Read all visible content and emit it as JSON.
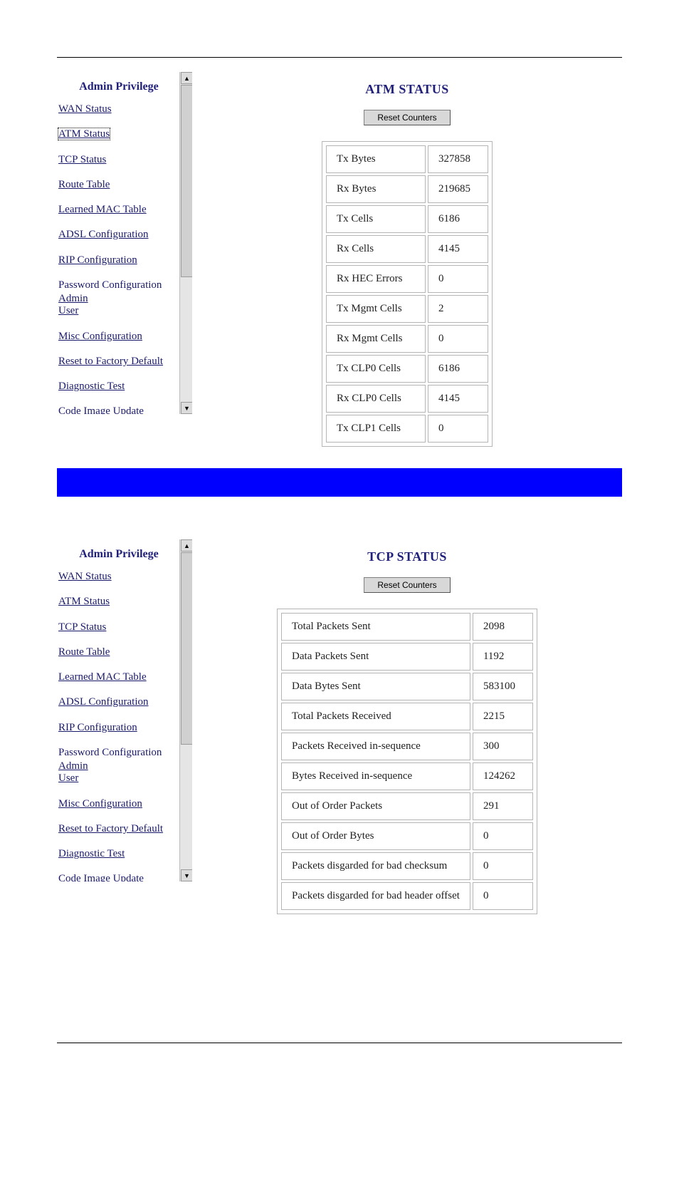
{
  "sidebar": {
    "title": "Admin Privilege",
    "items": [
      {
        "label": "WAN Status",
        "link": true
      },
      {
        "label": "ATM Status",
        "link": true,
        "selected_in_top": true
      },
      {
        "label": "TCP Status",
        "link": true
      },
      {
        "label": "Route Table",
        "link": true
      },
      {
        "label": "Learned MAC Table",
        "link": true
      },
      {
        "label": "ADSL Configuration",
        "link": true
      },
      {
        "label": "RIP Configuration",
        "link": true
      },
      {
        "label": "Password Configuration",
        "link": false,
        "sub": [
          {
            "label": "Admin"
          },
          {
            "label": "User"
          }
        ]
      },
      {
        "label": "Misc Configuration",
        "link": true
      },
      {
        "label": "Reset to Factory Default",
        "link": true
      },
      {
        "label": "Diagnostic Test",
        "link": true
      },
      {
        "label": "Code Image Update",
        "link": true
      }
    ]
  },
  "panel_top": {
    "title": "ATM STATUS",
    "reset_button": "Reset Counters",
    "rows": [
      {
        "k": "Tx Bytes",
        "v": "327858"
      },
      {
        "k": "Rx Bytes",
        "v": "219685"
      },
      {
        "k": "Tx Cells",
        "v": "6186"
      },
      {
        "k": "Rx Cells",
        "v": "4145"
      },
      {
        "k": "Rx HEC Errors",
        "v": "0"
      },
      {
        "k": "Tx Mgmt Cells",
        "v": "2"
      },
      {
        "k": "Rx Mgmt Cells",
        "v": "0"
      },
      {
        "k": "Tx CLP0 Cells",
        "v": "6186"
      },
      {
        "k": "Rx CLP0 Cells",
        "v": "4145"
      },
      {
        "k": "Tx CLP1 Cells",
        "v": "0"
      }
    ]
  },
  "panel_bottom": {
    "title": "TCP STATUS",
    "reset_button": "Reset Counters",
    "rows": [
      {
        "k": "Total Packets Sent",
        "v": "2098"
      },
      {
        "k": "Data Packets Sent",
        "v": "1192"
      },
      {
        "k": "Data Bytes Sent",
        "v": "583100"
      },
      {
        "k": "Total Packets Received",
        "v": "2215"
      },
      {
        "k": "Packets Received in-sequence",
        "v": "300"
      },
      {
        "k": "Bytes Received in-sequence",
        "v": "124262"
      },
      {
        "k": "Out of Order Packets",
        "v": "291"
      },
      {
        "k": "Out of Order Bytes",
        "v": "0"
      },
      {
        "k": "Packets disgarded for bad checksum",
        "v": "0"
      },
      {
        "k": "Packets disgarded for bad header offset",
        "v": "0"
      }
    ]
  }
}
